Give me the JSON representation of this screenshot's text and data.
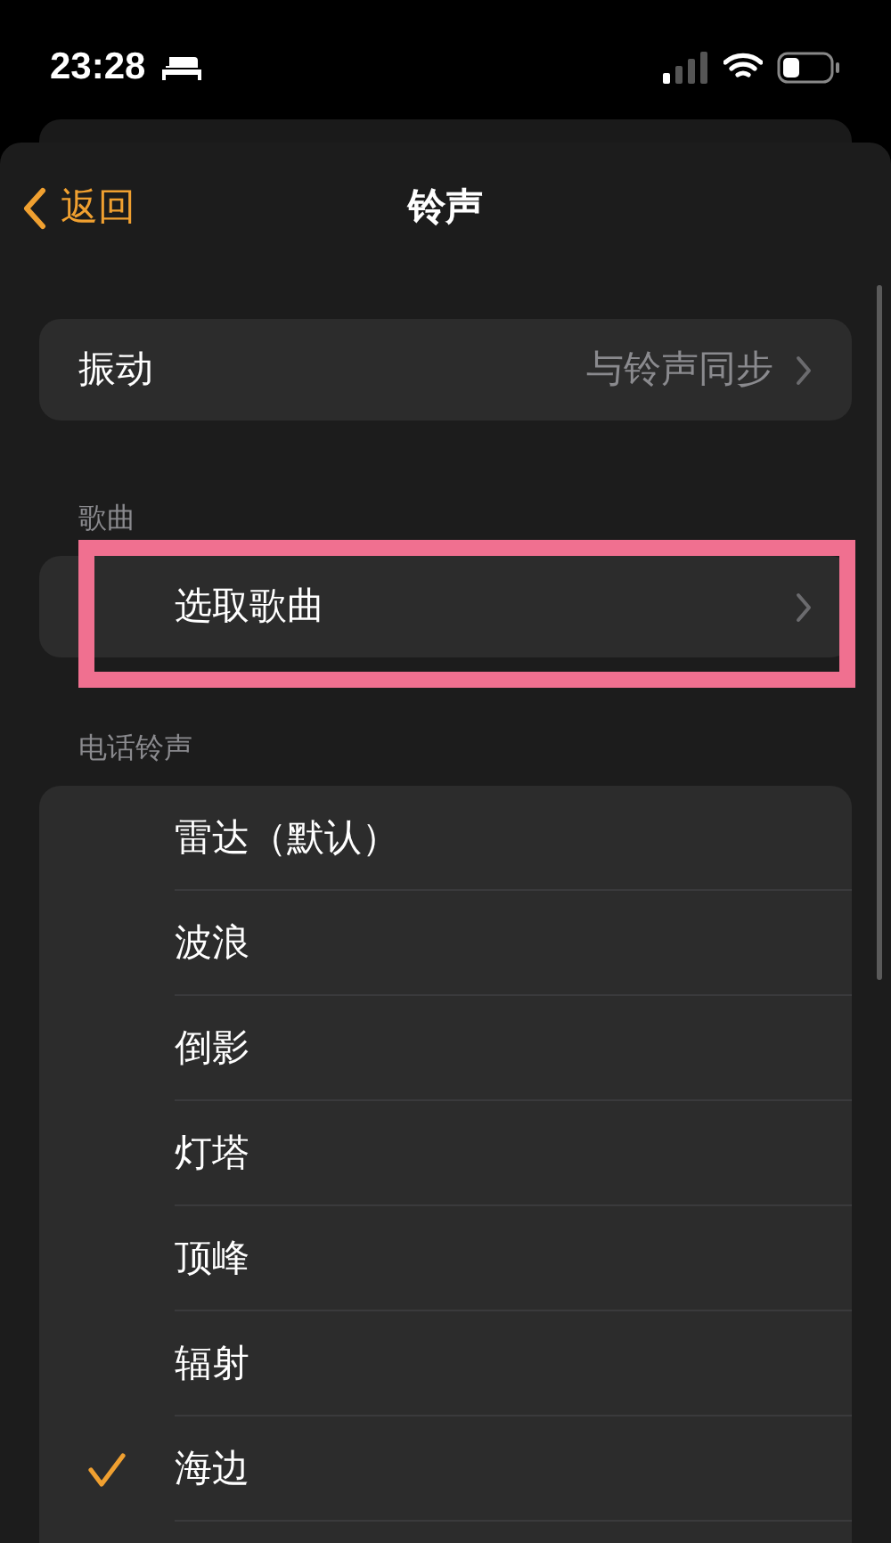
{
  "status_bar": {
    "time": "23:28"
  },
  "nav": {
    "back": "返回",
    "title": "铃声"
  },
  "vibration": {
    "label": "振动",
    "value": "与铃声同步"
  },
  "songs": {
    "header": "歌曲",
    "item": "选取歌曲",
    "highlighted": true
  },
  "ringtones": {
    "header": "电话铃声",
    "items": [
      {
        "label": "雷达（默认）",
        "selected": false
      },
      {
        "label": "波浪",
        "selected": false
      },
      {
        "label": "倒影",
        "selected": false
      },
      {
        "label": "灯塔",
        "selected": false
      },
      {
        "label": "顶峰",
        "selected": false
      },
      {
        "label": "辐射",
        "selected": false
      },
      {
        "label": "海边",
        "selected": true
      }
    ]
  }
}
